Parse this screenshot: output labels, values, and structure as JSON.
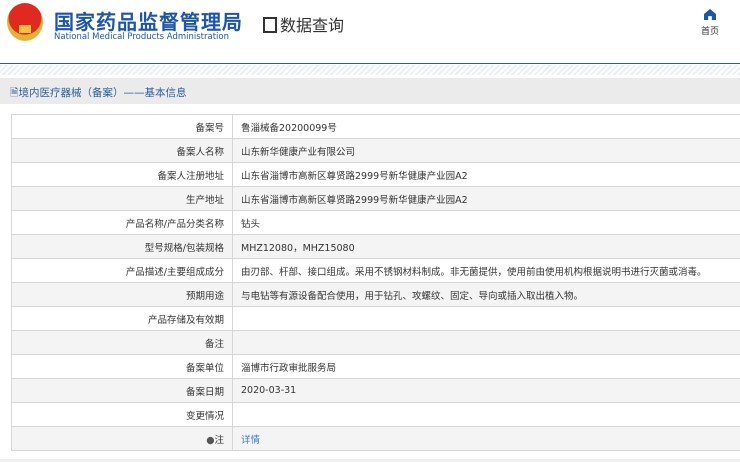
{
  "header": {
    "title_cn": "国家药品监督管理局",
    "title_en": "National Medical Products Administration",
    "data_query": "数据查询",
    "home": "首页"
  },
  "breadcrumb": "境内医疗器械（备案）——基本信息",
  "rows": [
    {
      "label": "备案号",
      "value": "鲁淄械备20200099号"
    },
    {
      "label": "备案人名称",
      "value": "山东新华健康产业有限公司"
    },
    {
      "label": "备案人注册地址",
      "value": "山东省淄博市高新区尊贤路2999号新华健康产业园A2"
    },
    {
      "label": "生产地址",
      "value": "山东省淄博市高新区尊贤路2999号新华健康产业园A2"
    },
    {
      "label": "产品名称/产品分类名称",
      "value": "钻头"
    },
    {
      "label": "型号规格/包装规格",
      "value": "MHZ12080，MHZ15080"
    },
    {
      "label": "产品描述/主要组成成分",
      "value": "由刃部、杆部、接口组成。采用不锈钢材料制成。非无菌提供，使用前由使用机构根据说明书进行灭菌或消毒。"
    },
    {
      "label": "预期用途",
      "value": "与电钻等有源设备配合使用，用于钻孔、攻螺纹、固定、导向或插入取出植入物。"
    },
    {
      "label": "产品存储及有效期",
      "value": ""
    },
    {
      "label": "备注",
      "value": ""
    },
    {
      "label": "备案单位",
      "value": "淄博市行政审批服务局"
    },
    {
      "label": "备案日期",
      "value": "2020-03-31"
    },
    {
      "label": "变更情况",
      "value": ""
    }
  ],
  "note": {
    "label": "注",
    "link": "详情"
  }
}
